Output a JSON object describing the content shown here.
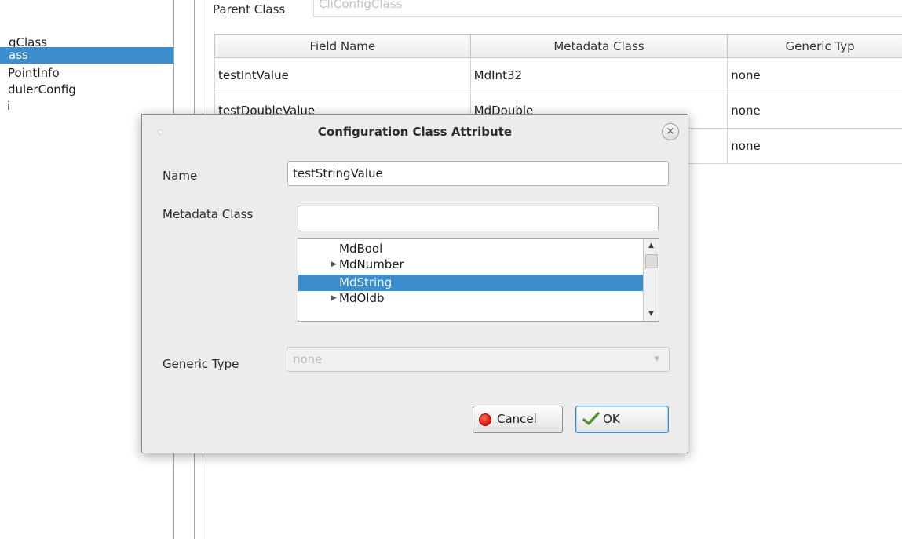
{
  "tree": {
    "items": [
      {
        "label": "gClass",
        "selected": false
      },
      {
        "label": "ass",
        "selected": true
      },
      {
        "label": "PointInfo",
        "selected": false
      },
      {
        "label": "dulerConfig",
        "selected": false
      },
      {
        "label": "i",
        "selected": false
      }
    ]
  },
  "parent_class": {
    "label": "Parent Class",
    "value": "CliConfigClass"
  },
  "fields_table": {
    "headers": [
      "Field Name",
      "Metadata Class",
      "Generic Typ"
    ],
    "rows": [
      [
        "testIntValue",
        "MdInt32",
        "none"
      ],
      [
        "testDoubleValue",
        "MdDouble",
        "none"
      ],
      [
        "",
        "",
        "none"
      ]
    ]
  },
  "dialog": {
    "title": "Configuration Class Attribute",
    "close_glyph": "×",
    "name_label": "Name",
    "name_value": "testStringValue",
    "metadata_label": "Metadata Class",
    "metadata_filter_value": "",
    "metadata_list": [
      {
        "label": "MdBool",
        "expandable": false,
        "selected": false
      },
      {
        "label": "MdNumber",
        "expandable": true,
        "selected": false
      },
      {
        "label": "MdString",
        "expandable": false,
        "selected": true
      },
      {
        "label": "MdOldb",
        "expandable": true,
        "selected": false
      }
    ],
    "generic_label": "Generic Type",
    "generic_value": "none",
    "cancel_label_mnemonic": "C",
    "cancel_label_rest": "ancel",
    "ok_label_mnemonic": "O",
    "ok_label_rest": "K"
  },
  "colors": {
    "selection": "#3b8dcc",
    "dialog_bg": "#ececec"
  }
}
